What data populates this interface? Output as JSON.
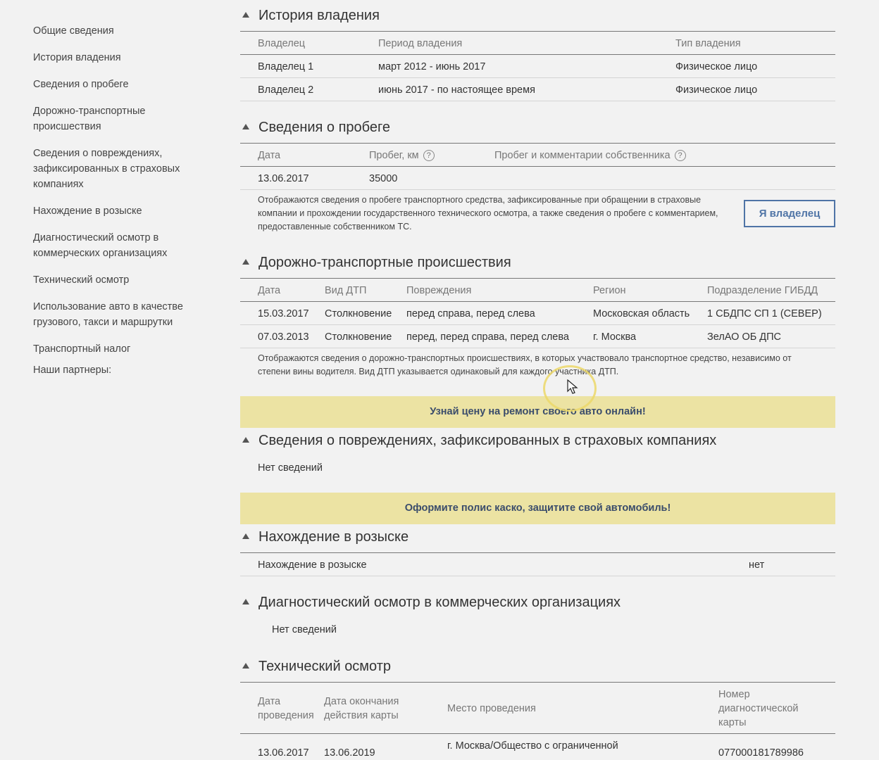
{
  "sidebar": {
    "items": [
      {
        "label": "Общие сведения"
      },
      {
        "label": "История владения"
      },
      {
        "label": "Сведения о пробеге"
      },
      {
        "label": "Дорожно-транспортные происшествия"
      },
      {
        "label": "Сведения о повреждениях, зафиксированных в страховых компаниях"
      },
      {
        "label": "Нахождение в розыске"
      },
      {
        "label": "Диагностический осмотр в коммерческих организациях"
      },
      {
        "label": "Технический осмотр"
      },
      {
        "label": "Использование авто в качестве грузового, такси и маршрутки"
      },
      {
        "label": "Транспортный налог"
      }
    ],
    "partners_label": "Наши партнеры:"
  },
  "ownership": {
    "title": "История владения",
    "headers": [
      "Владелец",
      "Период владения",
      "Тип владения"
    ],
    "rows": [
      [
        "Владелец 1",
        "март 2012 - июнь 2017",
        "Физическое лицо"
      ],
      [
        "Владелец 2",
        "июнь 2017 - по настоящее время",
        "Физическое лицо"
      ]
    ]
  },
  "mileage": {
    "title": "Сведения о пробеге",
    "headers": [
      "Дата",
      "Пробег, км",
      "Пробег и комментарии собственника"
    ],
    "help_glyph": "?",
    "rows": [
      [
        "13.06.2017",
        "35000"
      ]
    ],
    "note": "Отображаются сведения о пробеге транспортного средства, зафиксированные при обращении в страховые компании и прохождении государственного технического осмотра, а также сведения о пробеге с комментарием, предоставленные собственником ТС.",
    "owner_button": "Я владелец"
  },
  "accidents": {
    "title": "Дорожно-транспортные происшествия",
    "headers": [
      "Дата",
      "Вид ДТП",
      "Повреждения",
      "Регион",
      "Подразделение ГИБДД"
    ],
    "rows": [
      [
        "15.03.2017",
        "Столкновение",
        "перед справа, перед слева",
        "Московская область",
        "1 СБДПС СП 1 (СЕВЕР)"
      ],
      [
        "07.03.2013",
        "Столкновение",
        "перед, перед справа, перед слева",
        "г. Москва",
        "ЗелАО ОБ ДПС"
      ]
    ],
    "note": "Отображаются сведения о дорожно-транспортных происшествиях, в которых участвовало транспортное средство, независимо от степени вины водителя. Вид ДТП указывается одинаковый для каждого участника ДТП."
  },
  "banner1": "Узнай цену на ремонт своего авто онлайн!",
  "damages": {
    "title": "Сведения о повреждениях, зафиксированных в страховых компаниях",
    "empty": "Нет сведений"
  },
  "banner2": "Оформите полис каско, защитите свой автомобиль!",
  "wanted": {
    "title": "Нахождение в розыске",
    "label": "Нахождение в розыске",
    "value": "нет"
  },
  "diagnostic": {
    "title": "Диагностический осмотр в коммерческих организациях",
    "empty": "Нет сведений"
  },
  "inspection": {
    "title": "Технический осмотр",
    "headers": {
      "date_l1": "Дата",
      "date_l2": "проведения",
      "end_l1": "Дата окончания",
      "end_l2": "действия карты",
      "place": "Место проведения",
      "num_l1": "Номер",
      "num_l2": "диагностической",
      "num_l3": "карты"
    },
    "row": {
      "date": "13.06.2017",
      "end": "13.06.2019",
      "place": "г. Москва/Общество с ограниченной",
      "number": "077000181789986"
    }
  }
}
